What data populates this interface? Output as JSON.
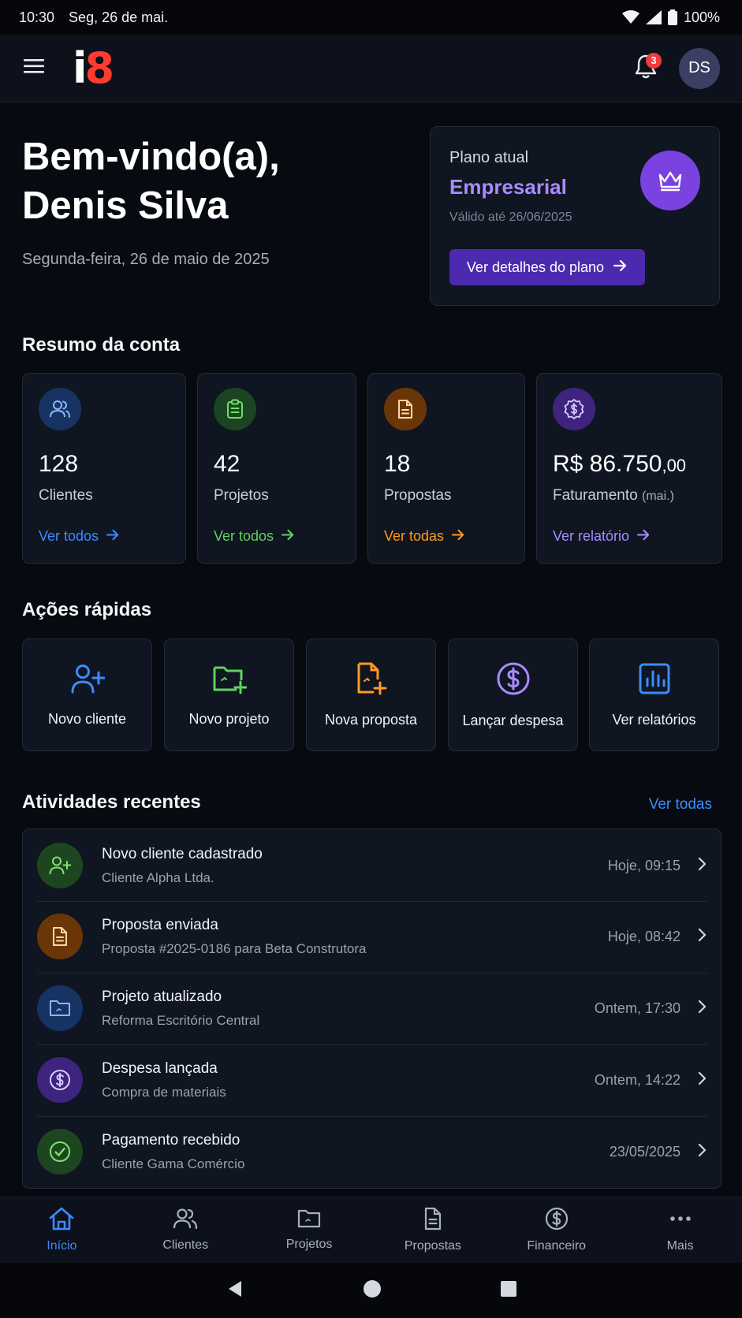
{
  "status": {
    "time": "10:30",
    "date": "Seg, 26 de mai.",
    "battery": "100%"
  },
  "header": {
    "logo_i": "i",
    "logo_8": "8",
    "notifications": "3",
    "avatar": "DS"
  },
  "welcome": {
    "line1": "Bem-vindo(a),",
    "line2": "Denis Silva",
    "date": "Segunda-feira, 26 de maio de 2025"
  },
  "plan": {
    "label": "Plano atual",
    "name": "Empresarial",
    "valid": "Válido até 26/06/2025",
    "button": "Ver detalhes do plano"
  },
  "summary": {
    "title": "Resumo da conta",
    "cards": [
      {
        "value": "128",
        "label": "Clientes",
        "link": "Ver todos",
        "color": "#3b8cff"
      },
      {
        "value": "42",
        "label": "Projetos",
        "link": "Ver todos",
        "color": "#5fd35a"
      },
      {
        "value": "18",
        "label": "Propostas",
        "link": "Ver todas",
        "color": "#ff9a1f"
      },
      {
        "value": "R$ 86.750",
        "cents": ",00",
        "label": "Faturamento",
        "label_suffix": "(mai.)",
        "link": "Ver relatório",
        "color": "#a98bff"
      }
    ]
  },
  "quick": {
    "title": "Ações rápidas",
    "items": [
      "Novo cliente",
      "Novo projeto",
      "Nova proposta",
      "Lançar despesa",
      "Ver relatórios"
    ]
  },
  "activities": {
    "title": "Atividades recentes",
    "see_all": "Ver todas",
    "items": [
      {
        "title": "Novo cliente cadastrado",
        "subtitle": "Cliente Alpha Ltda.",
        "time": "Hoje, 09:15"
      },
      {
        "title": "Proposta enviada",
        "subtitle": "Proposta #2025-0186 para Beta Construtora",
        "time": "Hoje, 08:42"
      },
      {
        "title": "Projeto atualizado",
        "subtitle": "Reforma Escritório Central",
        "time": "Ontem, 17:30"
      },
      {
        "title": "Despesa lançada",
        "subtitle": "Compra de materiais",
        "time": "Ontem, 14:22"
      },
      {
        "title": "Pagamento recebido",
        "subtitle": "Cliente Gama Comércio",
        "time": "23/05/2025"
      }
    ]
  },
  "nav": [
    "Início",
    "Clientes",
    "Projetos",
    "Propostas",
    "Financeiro",
    "Mais"
  ],
  "colors": {
    "accent": "#3b8cff",
    "plan": "#a98bff",
    "button": "#4c2ab0"
  }
}
